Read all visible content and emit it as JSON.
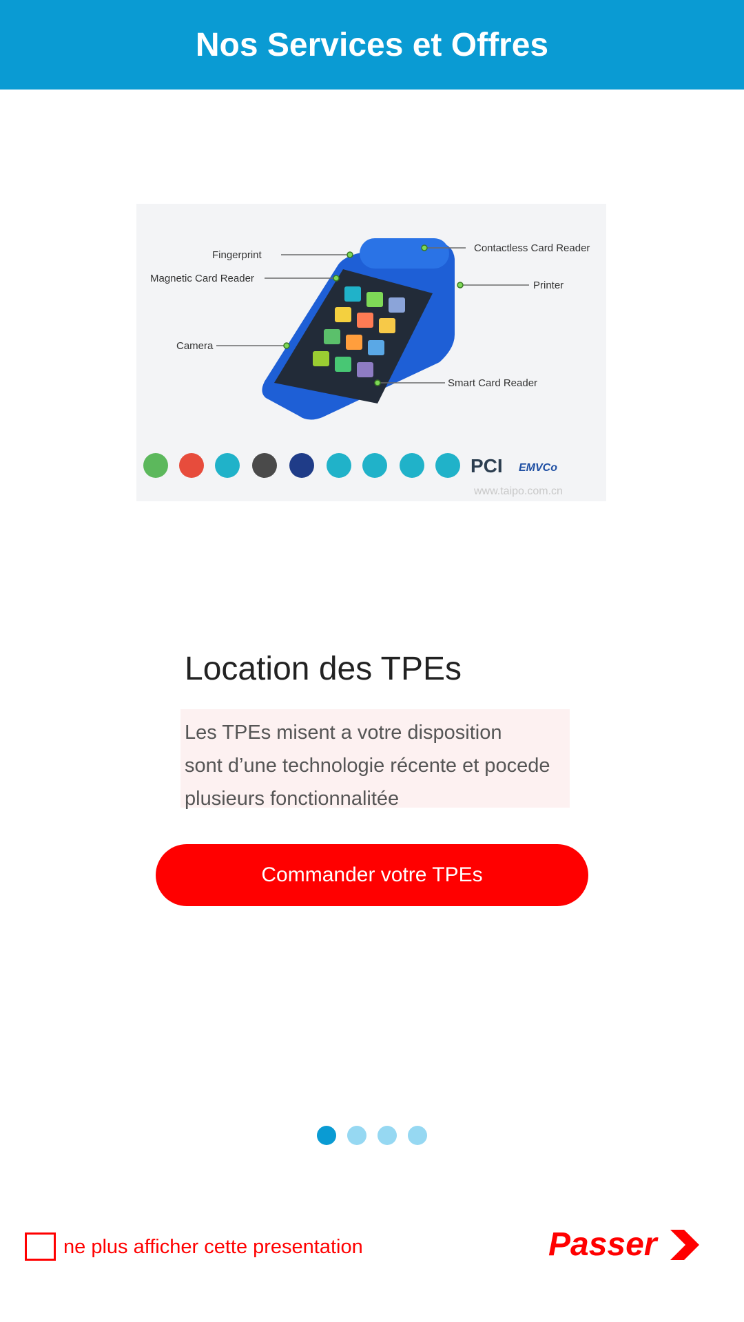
{
  "header": {
    "title": "Nos Services et Offres"
  },
  "slide": {
    "image": {
      "callouts": {
        "fingerprint": "Fingerprint",
        "magnetic": "Magnetic Card Reader",
        "camera": "Camera",
        "contactless": "Contactless Card Reader",
        "printer": "Printer",
        "smartcard": "Smart Card Reader"
      },
      "badges": {
        "pci": "PCI",
        "emvco": "EMVCo"
      },
      "watermark": "www.taipo.com.cn"
    },
    "title": "Location des TPEs",
    "description_lines": [
      "Les TPEs misent a votre disposition",
      "sont d’une technologie récente et pocede",
      "plusieurs fonctionnalitée"
    ],
    "cta_label": "Commander votre TPEs"
  },
  "pager": {
    "total": 4,
    "active": 1
  },
  "footer": {
    "checkbox_label": "ne plus afficher cette presentation",
    "checkbox_checked": false,
    "skip_label": "Passer"
  },
  "colors": {
    "primary": "#0a9bd3",
    "accent": "#ff0000",
    "dot_inactive": "#96d8f2"
  }
}
